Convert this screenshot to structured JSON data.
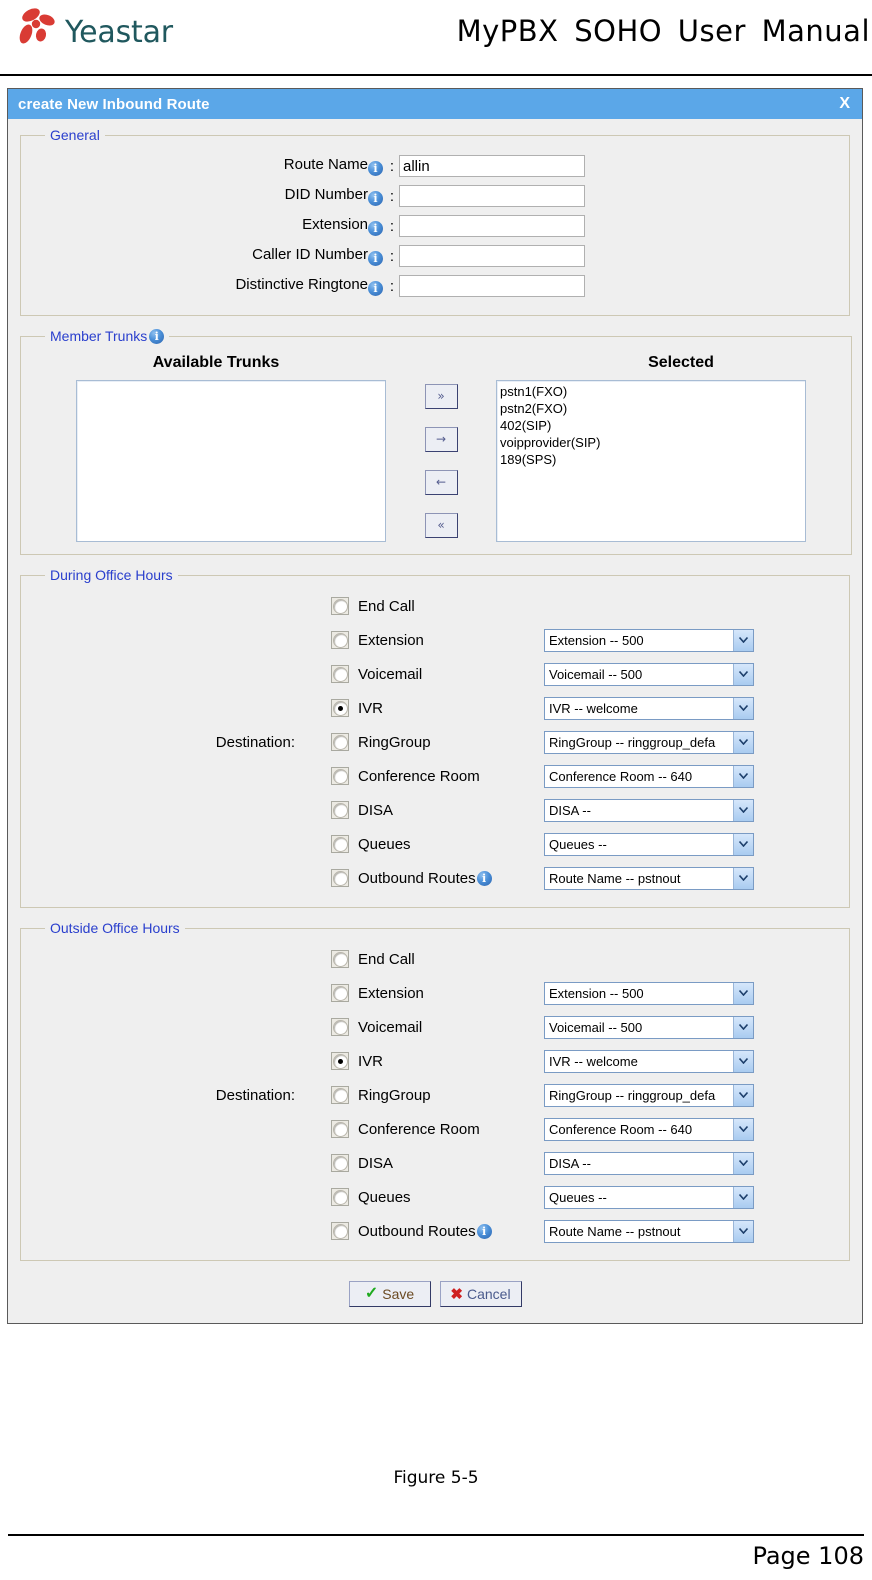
{
  "header": {
    "logo_text": "Yeastar",
    "logo_icon": "yeastar-pinwheel-logo",
    "manual_title": "MyPBX  SOHO  User  Manual"
  },
  "dialog": {
    "title": "create New Inbound Route",
    "close_label": "X",
    "general": {
      "legend": "General",
      "fields": [
        {
          "label": "Route Name",
          "value": "allin",
          "info": "i"
        },
        {
          "label": "DID Number",
          "value": "",
          "info": "i"
        },
        {
          "label": "Extension",
          "value": "",
          "info": "i"
        },
        {
          "label": "Caller ID Number",
          "value": "",
          "info": "i"
        },
        {
          "label": "Distinctive Ringtone",
          "value": "",
          "info": "i"
        }
      ],
      "colon": ":"
    },
    "member_trunks": {
      "legend": "Member Trunks",
      "info": "i",
      "available_header": "Available Trunks",
      "selected_header": "Selected",
      "available_items": [],
      "selected_items": [
        "pstn1(FXO)",
        "pstn2(FXO)",
        "402(SIP)",
        "voipprovider(SIP)",
        "189(SPS)"
      ],
      "transfer_buttons": [
        {
          "label": "»",
          "name": "move-all-right-button"
        },
        {
          "label": "→",
          "name": "move-right-button"
        },
        {
          "label": "←",
          "name": "move-left-button"
        },
        {
          "label": "«",
          "name": "move-all-left-button"
        }
      ]
    },
    "during_office_hours": {
      "legend": "During Office Hours",
      "destination_label": "Destination:",
      "options": [
        {
          "label": "End Call",
          "selected": false,
          "has_select": false,
          "select_value": "",
          "info": ""
        },
        {
          "label": "Extension",
          "selected": false,
          "has_select": true,
          "select_value": "Extension -- 500",
          "info": ""
        },
        {
          "label": "Voicemail",
          "selected": false,
          "has_select": true,
          "select_value": "Voicemail -- 500",
          "info": ""
        },
        {
          "label": "IVR",
          "selected": true,
          "has_select": true,
          "select_value": "IVR -- welcome",
          "info": ""
        },
        {
          "label": "RingGroup",
          "selected": false,
          "has_select": true,
          "select_value": "RingGroup -- ringgroup_defa",
          "info": ""
        },
        {
          "label": "Conference Room",
          "selected": false,
          "has_select": true,
          "select_value": "Conference Room -- 640",
          "info": ""
        },
        {
          "label": "DISA",
          "selected": false,
          "has_select": true,
          "select_value": "DISA --",
          "info": ""
        },
        {
          "label": "Queues",
          "selected": false,
          "has_select": true,
          "select_value": "Queues --",
          "info": ""
        },
        {
          "label": "Outbound Routes",
          "selected": false,
          "has_select": true,
          "select_value": "Route Name -- pstnout",
          "info": "i"
        }
      ]
    },
    "outside_office_hours": {
      "legend": "Outside Office Hours",
      "destination_label": "Destination:",
      "options": [
        {
          "label": "End Call",
          "selected": false,
          "has_select": false,
          "select_value": "",
          "info": ""
        },
        {
          "label": "Extension",
          "selected": false,
          "has_select": true,
          "select_value": "Extension -- 500",
          "info": ""
        },
        {
          "label": "Voicemail",
          "selected": false,
          "has_select": true,
          "select_value": "Voicemail -- 500",
          "info": ""
        },
        {
          "label": "IVR",
          "selected": true,
          "has_select": true,
          "select_value": "IVR -- welcome",
          "info": ""
        },
        {
          "label": "RingGroup",
          "selected": false,
          "has_select": true,
          "select_value": "RingGroup -- ringgroup_defa",
          "info": ""
        },
        {
          "label": "Conference Room",
          "selected": false,
          "has_select": true,
          "select_value": "Conference Room -- 640",
          "info": ""
        },
        {
          "label": "DISA",
          "selected": false,
          "has_select": true,
          "select_value": "DISA --",
          "info": ""
        },
        {
          "label": "Queues",
          "selected": false,
          "has_select": true,
          "select_value": "Queues --",
          "info": ""
        },
        {
          "label": "Outbound Routes",
          "selected": false,
          "has_select": true,
          "select_value": "Route Name -- pstnout",
          "info": "i"
        }
      ]
    },
    "actions": {
      "save_label": "Save",
      "save_icon": "green-check-icon",
      "cancel_label": "Cancel",
      "cancel_icon": "red-x-icon"
    }
  },
  "figure_caption": "Figure 5-5",
  "page_number": "Page 108",
  "colors": {
    "titlebar": "#5ba7e8",
    "legend_text": "#2a3fcd",
    "logo_red": "#d93b34",
    "logo_teal": "#20585e"
  }
}
